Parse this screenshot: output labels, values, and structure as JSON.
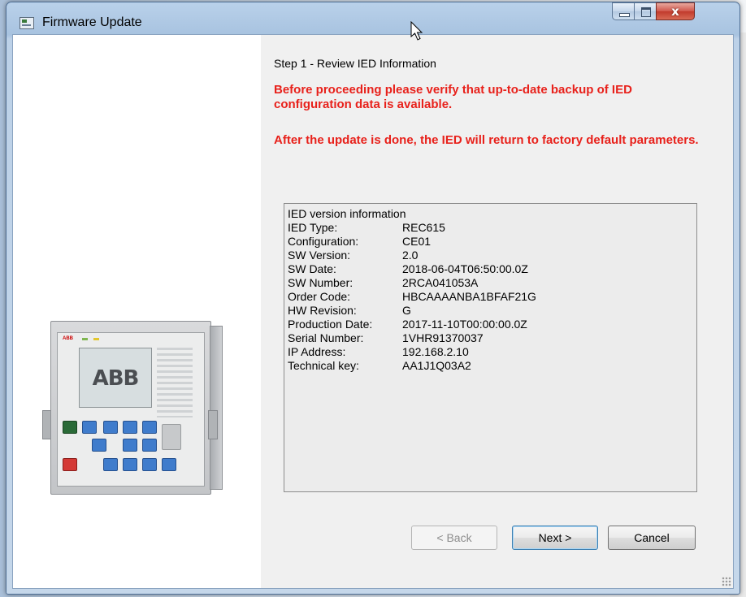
{
  "window": {
    "title": "Firmware Update",
    "close_glyph": "x"
  },
  "device_image": {
    "logo": "ABB",
    "brand_small": "ABB"
  },
  "step_title": "Step 1 - Review IED Information",
  "warnings": [
    "Before proceeding please verify that up-to-date backup of IED configuration data is available.",
    "After the update is done, the IED will return to factory default parameters."
  ],
  "info": {
    "title": "IED version information",
    "rows": [
      {
        "label": "IED Type:",
        "value": "REC615"
      },
      {
        "label": "Configuration:",
        "value": "CE01"
      },
      {
        "label": "SW Version:",
        "value": "2.0"
      },
      {
        "label": "SW Date:",
        "value": "2018-06-04T06:50:00.0Z"
      },
      {
        "label": "SW Number:",
        "value": "2RCA041053A"
      },
      {
        "label": "Order Code:",
        "value": "HBCAAAANBA1BFAF21G"
      },
      {
        "label": "HW Revision:",
        "value": "G"
      },
      {
        "label": "Production Date:",
        "value": "2017-11-10T00:00:00.0Z"
      },
      {
        "label": "Serial Number:",
        "value": "1VHR91370037"
      },
      {
        "label": "IP Address:",
        "value": "192.168.2.10"
      },
      {
        "label": "Technical key:",
        "value": "AA1J1Q03A2"
      }
    ]
  },
  "buttons": {
    "back": "< Back",
    "next": "Next >",
    "cancel": "Cancel"
  },
  "colors": {
    "warning": "#e8211b",
    "dialog_bg": "#f0f0f0"
  }
}
